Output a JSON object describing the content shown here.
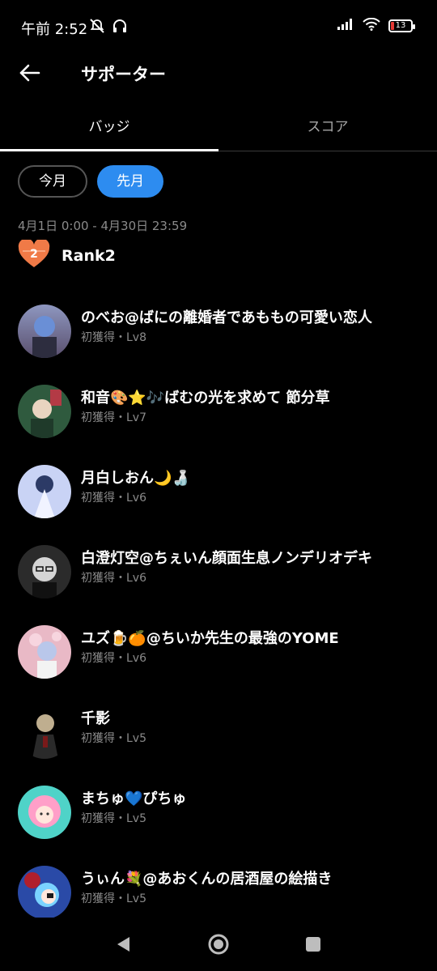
{
  "status": {
    "time": "午前 2:52",
    "battery": "13"
  },
  "header": {
    "title": "サポーター"
  },
  "tabs": [
    {
      "label": "バッジ",
      "active": true
    },
    {
      "label": "スコア",
      "active": false
    }
  ],
  "filters": {
    "this_month": "今月",
    "last_month": "先月",
    "selected": "先月"
  },
  "date_range": "4月1日 0:00 - 4月30日 23:59",
  "rank": {
    "badge_number": "2",
    "label": "Rank2"
  },
  "supporters": [
    {
      "name": "のべお@ばにの離婚者であももの可愛い恋人",
      "sub": "初獲得・Lv8",
      "avatar_colors": [
        "#5a4f6d",
        "#8e97c0"
      ]
    },
    {
      "name": "和音🎨⭐🎶ばむの光を求めて 節分草",
      "sub": "初獲得・Lv7",
      "avatar_colors": [
        "#2f5a3e",
        "#b33a45"
      ]
    },
    {
      "name": "月白しおん🌙🍶",
      "sub": "初獲得・Lv6",
      "avatar_colors": [
        "#a7b6e6",
        "#f1f3ff"
      ]
    },
    {
      "name": "白澄灯空@ちぇいん顔面生息ノンデリオデキ",
      "sub": "初獲得・Lv6",
      "avatar_colors": [
        "#2b2b2b",
        "#d5d5d5"
      ]
    },
    {
      "name": "ユズ🍺🍊@ちいか先生の最強のYOME",
      "sub": "初獲得・Lv6",
      "avatar_colors": [
        "#e9b9c6",
        "#b9c7ea"
      ]
    },
    {
      "name": "千影",
      "sub": "初獲得・Lv5",
      "avatar_colors": [
        "#000000",
        "#bfae8f"
      ]
    },
    {
      "name": "まちゅ💙ぴちゅ",
      "sub": "初獲得・Lv5",
      "avatar_colors": [
        "#4fd3c8",
        "#ff9fc8"
      ]
    },
    {
      "name": "うぃん💐@あおくんの居酒屋の絵描き",
      "sub": "初獲得・Lv5",
      "avatar_colors": [
        "#2a4aa7",
        "#7ad3ff"
      ]
    }
  ],
  "colors": {
    "accent": "#2d8cf0",
    "rank_badge": "#f07a47",
    "muted_text": "#8a8a8a"
  },
  "icons": {
    "back": "back-arrow-icon",
    "rank": "heart-badge-icon",
    "nav_back": "nav-back-icon",
    "nav_home": "nav-home-icon",
    "nav_recent": "nav-recent-icon"
  }
}
